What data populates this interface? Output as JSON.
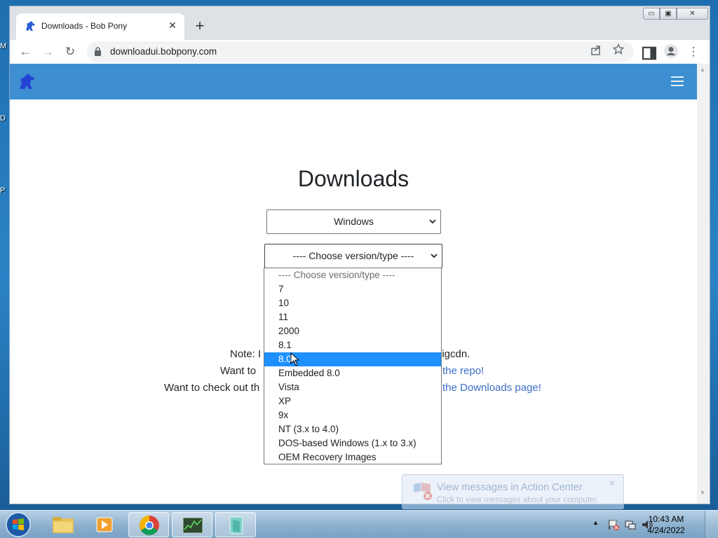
{
  "desktop": {
    "labels": [
      "M",
      "D",
      "P"
    ]
  },
  "browser": {
    "tab": {
      "title": "Downloads - Bob Pony",
      "close": "✕"
    },
    "new_tab": "+",
    "window_controls": {
      "minimize": "▭",
      "maximize": "▣",
      "close": "✕"
    },
    "toolbar": {
      "back": "←",
      "forward": "→",
      "reload": "↻",
      "url": "downloadui.bobpony.com",
      "menu": "⋮"
    }
  },
  "page": {
    "title": "Downloads",
    "os_select": {
      "value": "Windows"
    },
    "version_select": {
      "value": "---- Choose version/type ----"
    },
    "dropdown": {
      "options": [
        "---- Choose version/type ----",
        "7",
        "10",
        "11",
        "2000",
        "8.1",
        "8.0",
        "Embedded 8.0",
        "Vista",
        "XP",
        "9x",
        "NT (3.x to 4.0)",
        "DOS-based Windows (1.x to 3.x)",
        "OEM Recovery Images"
      ],
      "highlighted": "8.0"
    },
    "notes": [
      {
        "prefix": "Note: I",
        "suffix": "oigcdn.",
        "link": ""
      },
      {
        "prefix": "Want to ",
        "suffix": "",
        "link": "the repo!"
      },
      {
        "prefix": "Want to check out th",
        "suffix": "",
        "link": "the Downloads page!"
      }
    ]
  },
  "notification": {
    "title": "View messages in Action Center",
    "subtitle": "Click to view messages about your computer.",
    "close": "✕"
  },
  "taskbar": {
    "clock_time": "10:43 AM",
    "clock_date": "4/24/2022"
  },
  "colors": {
    "navbar": "#3d8fd1",
    "highlight": "#1e90ff",
    "link": "#0d6efd"
  }
}
